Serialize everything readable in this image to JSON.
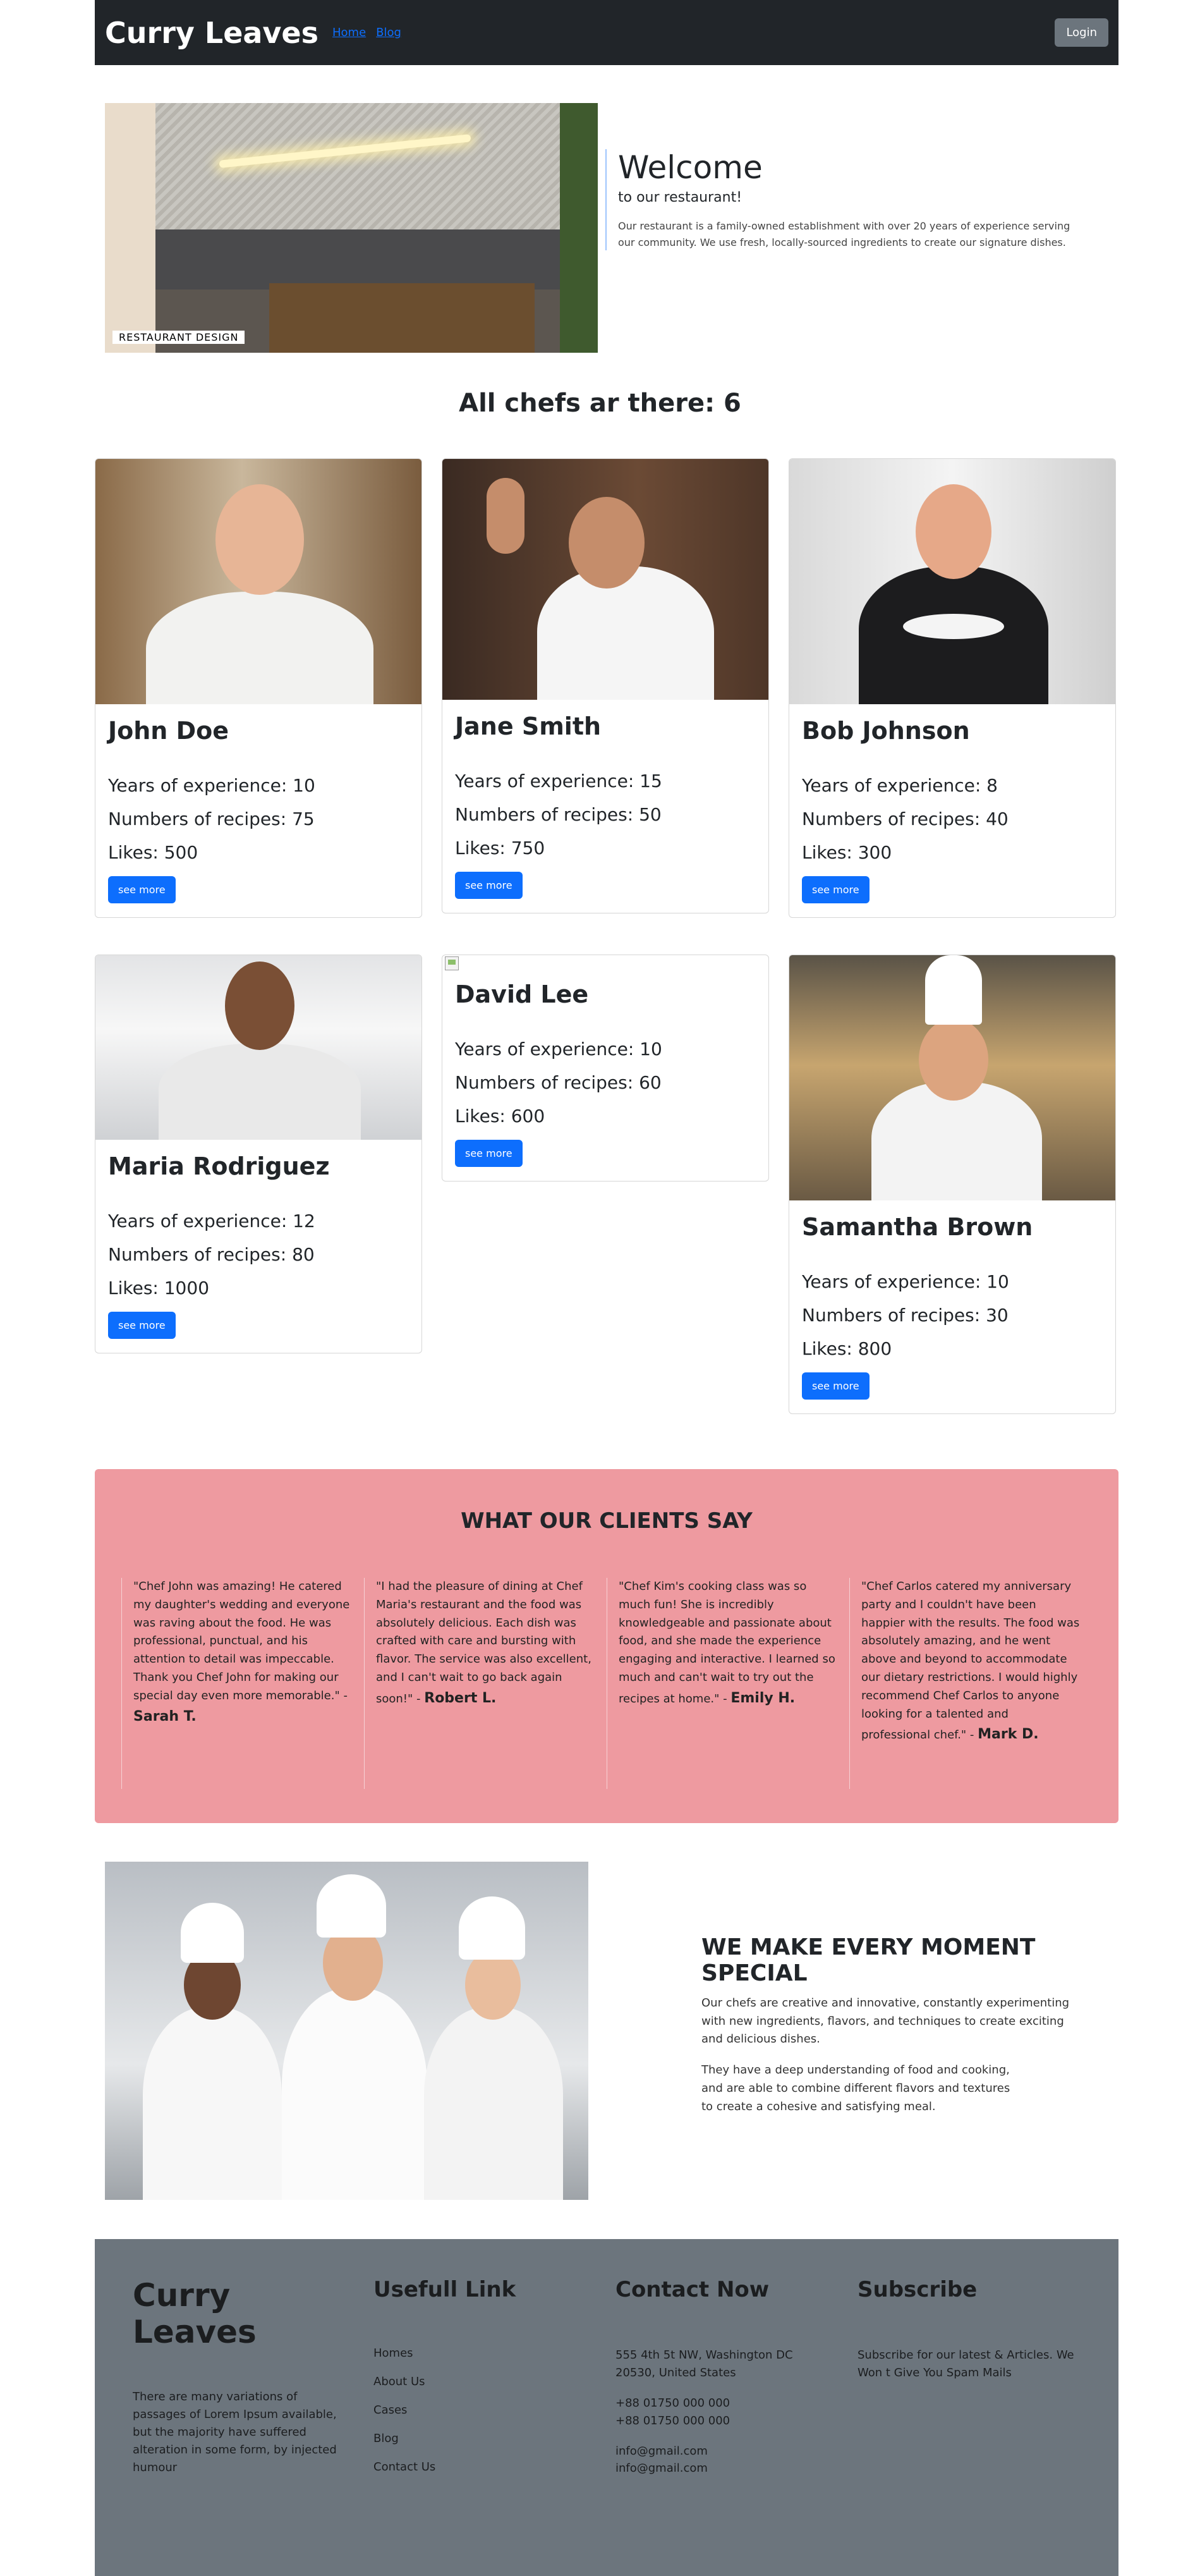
{
  "nav": {
    "brand": "Curry Leaves",
    "links": [
      "Home",
      "Blog"
    ],
    "login": "Login"
  },
  "hero": {
    "image_caption": "RESTAURANT DESIGN",
    "title": "Welcome",
    "subtitle": "to our restaurant!",
    "description": "Our restaurant is a family-owned establishment with over 20 years of experience serving our community. We use fresh, locally-sourced ingredients to create our signature dishes."
  },
  "chefs_title": "All chefs ar there: 6",
  "chefs": [
    {
      "name": "John Doe",
      "experience": "Years of experience: 10",
      "recipes": "Numbers of recipes: 75",
      "likes": "Likes: 500",
      "button": "see more"
    },
    {
      "name": "Jane Smith",
      "experience": "Years of experience: 15",
      "recipes": "Numbers of recipes: 50",
      "likes": "Likes: 750",
      "button": "see more"
    },
    {
      "name": "Bob Johnson",
      "experience": "Years of experience: 8",
      "recipes": "Numbers of recipes: 40",
      "likes": "Likes: 300",
      "button": "see more"
    },
    {
      "name": "Maria Rodriguez",
      "experience": "Years of experience: 12",
      "recipes": "Numbers of recipes: 80",
      "likes": "Likes: 1000",
      "button": "see more"
    },
    {
      "name": "David Lee",
      "experience": "Years of experience: 10",
      "recipes": "Numbers of recipes: 60",
      "likes": "Likes: 600",
      "button": "see more"
    },
    {
      "name": "Samantha Brown",
      "experience": "Years of experience: 10",
      "recipes": "Numbers of recipes: 30",
      "likes": "Likes: 800",
      "button": "see more"
    }
  ],
  "testimonials": {
    "title": "WHAT OUR CLIENTS SAY",
    "items": [
      {
        "quote": "\"Chef John was amazing! He catered my daughter's wedding and everyone was raving about the food. He was professional, punctual, and his attention to detail was impeccable. Thank you Chef John for making our special day even more memorable.\" - ",
        "author": "Sarah T."
      },
      {
        "quote": "\"I had the pleasure of dining at Chef Maria's restaurant and the food was absolutely delicious. Each dish was crafted with care and bursting with flavor. The service was also excellent, and I can't wait to go back again soon!\" - ",
        "author": "Robert L."
      },
      {
        "quote": "\"Chef Kim's cooking class was so much fun! She is incredibly knowledgeable and passionate about food, and she made the experience engaging and interactive. I learned so much and can't wait to try out the recipes at home.\" - ",
        "author": "Emily H."
      },
      {
        "quote": "\"Chef Carlos catered my anniversary party and I couldn't have been happier with the results. The food was absolutely amazing, and he went above and beyond to accommodate our dietary restrictions. I would highly recommend Chef Carlos to anyone looking for a talented and professional chef.\" - ",
        "author": "Mark D."
      }
    ]
  },
  "moment": {
    "title": "WE MAKE EVERY MOMENT SPECIAL",
    "p1": "Our chefs are creative and innovative, constantly experimenting with new ingredients, flavors, and techniques to create exciting and delicious dishes.",
    "p2": "They have a deep understanding of food and cooking, and are able to combine different flavors and textures to create a cohesive and satisfying meal."
  },
  "footer": {
    "brand": "Curry Leaves",
    "about": "There are many variations of passages of Lorem Ipsum available, but the majority have suffered alteration in some form, by injected humour",
    "links_title": "Usefull Link",
    "links": [
      "Homes",
      "About Us",
      "Cases",
      "Blog",
      "Contact Us"
    ],
    "contact_title": "Contact Now",
    "address": "555 4th 5t NW, Washington DC 20530, United States",
    "phone1": "+88 01750 000 000",
    "phone2": "+88 01750 000 000",
    "email1": "info@gmail.com",
    "email2": "info@gmail.com",
    "subscribe_title": "Subscribe",
    "subscribe_text": "Subscribe for our latest & Articles. We Won t Give You Spam Mails"
  },
  "colors": {
    "navbar": "#212529",
    "primary": "#0d6efd",
    "secondary": "#6c757d",
    "testimonials_bg": "#ee9aa0"
  }
}
